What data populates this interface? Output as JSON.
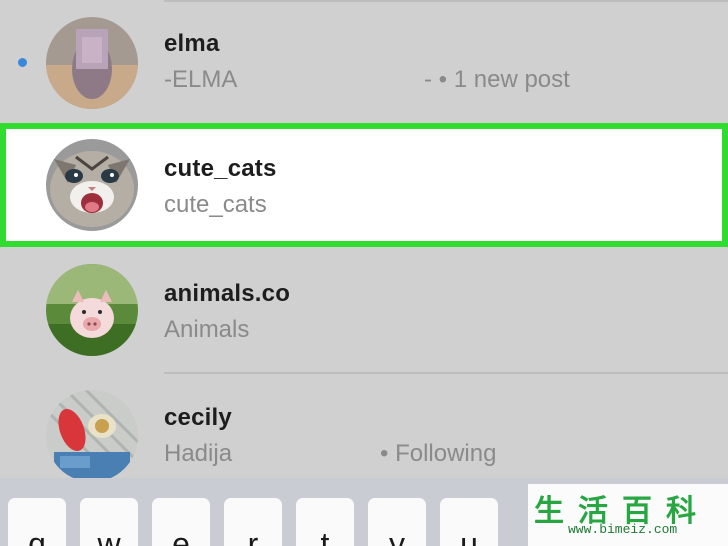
{
  "results": [
    {
      "username": "elma",
      "fullname": "-ELMA",
      "extra": "- • 1 new post",
      "unread": true,
      "highlighted": false
    },
    {
      "username": "cute_cats",
      "fullname": "cute_cats",
      "extra": "",
      "unread": false,
      "highlighted": true
    },
    {
      "username": "animals.co",
      "fullname": "Animals",
      "extra": "",
      "unread": false,
      "highlighted": false
    },
    {
      "username": "cecily",
      "fullname": "Hadija",
      "extra": "• Following",
      "unread": false,
      "highlighted": false
    }
  ],
  "keyboard": {
    "keys": [
      "q",
      "w",
      "e",
      "r",
      "t",
      "y",
      "u"
    ]
  },
  "watermark": {
    "text": "生活百科",
    "url": "www.bimeiz.com"
  },
  "colors": {
    "highlight_border": "#2fdc2f",
    "unread_dot": "#3b88db",
    "list_bg": "#d0d0d0"
  }
}
